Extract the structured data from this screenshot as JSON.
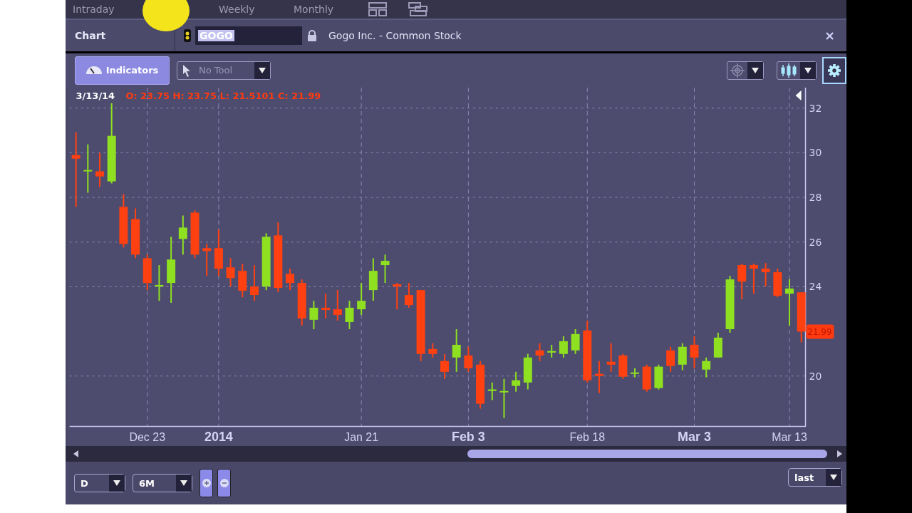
{
  "tabs": [
    {
      "label": "Intraday",
      "selected": false
    },
    {
      "label": "Weekly",
      "selected": false
    },
    {
      "label": "Monthly",
      "selected": false
    }
  ],
  "header": {
    "title": "Chart",
    "symbol": "GOGO",
    "company": "Gogo Inc. - Common Stock",
    "close": "×"
  },
  "toolbar": {
    "indicators": "Indicators",
    "tool": {
      "value": "No Tool",
      "disabled": true
    }
  },
  "chart": {
    "date": "3/13/14",
    "ohlc": "O: 23.75 H: 23.75 L: 21.5101 C: 21.99",
    "last_price": "21.99",
    "chart_data": {
      "type": "candlestick",
      "categories": [
        null,
        null,
        null,
        null,
        null,
        null,
        "Dec 23",
        null,
        null,
        null,
        null,
        null,
        "2014",
        null,
        null,
        null,
        null,
        null,
        null,
        null,
        null,
        null,
        null,
        null,
        "Jan 21",
        null,
        null,
        null,
        null,
        null,
        null,
        null,
        null,
        "Feb 3",
        null,
        null,
        null,
        null,
        null,
        null,
        null,
        null,
        null,
        "Feb 18",
        null,
        null,
        null,
        null,
        null,
        null,
        null,
        null,
        "Mar 3",
        null,
        null,
        null,
        null,
        null,
        null,
        null,
        "Mar 13",
        null
      ],
      "ohlc": [
        [
          29.9,
          30.92,
          27.58,
          29.74
        ],
        [
          29.2,
          30.38,
          28.21,
          29.23
        ],
        [
          29.17,
          30.0,
          28.47,
          28.94
        ],
        [
          28.72,
          32.22,
          28.63,
          30.76
        ],
        [
          27.58,
          28.15,
          25.76,
          25.92
        ],
        [
          27.03,
          27.51,
          25.28,
          25.44
        ],
        [
          25.28,
          25.44,
          23.85,
          24.17
        ],
        [
          24.01,
          24.97,
          23.37,
          24.08
        ],
        [
          24.17,
          26.24,
          23.28,
          25.22
        ],
        [
          26.14,
          27.19,
          25.44,
          26.65
        ],
        [
          27.32,
          27.42,
          25.28,
          25.44
        ],
        [
          25.73,
          25.92,
          24.49,
          25.6
        ],
        [
          25.73,
          26.56,
          24.49,
          24.81
        ],
        [
          24.87,
          25.28,
          24.01,
          24.39
        ],
        [
          24.71,
          25.03,
          23.53,
          23.82
        ],
        [
          24.01,
          24.97,
          23.37,
          23.63
        ],
        [
          24.01,
          26.4,
          23.85,
          26.24
        ],
        [
          26.3,
          26.88,
          23.76,
          23.95
        ],
        [
          24.58,
          24.81,
          23.85,
          24.17
        ],
        [
          24.17,
          24.33,
          22.26,
          22.58
        ],
        [
          22.52,
          23.37,
          22.1,
          23.06
        ],
        [
          23.06,
          23.69,
          22.58,
          22.96
        ],
        [
          22.99,
          23.85,
          22.48,
          22.74
        ],
        [
          22.42,
          23.37,
          22.1,
          23.06
        ],
        [
          22.99,
          24.17,
          22.74,
          23.37
        ],
        [
          23.85,
          25.28,
          23.37,
          24.71
        ],
        [
          24.97,
          25.44,
          24.17,
          25.16
        ],
        [
          24.11,
          24.17,
          22.99,
          24.01
        ],
        [
          23.63,
          24.17,
          23.06,
          23.18
        ],
        [
          23.85,
          23.85,
          20.67,
          20.99
        ],
        [
          21.21,
          21.47,
          20.83,
          20.99
        ],
        [
          20.67,
          20.99,
          19.87,
          20.19
        ],
        [
          20.83,
          22.1,
          20.19,
          21.4
        ],
        [
          20.92,
          21.31,
          20.19,
          20.35
        ],
        [
          20.51,
          20.67,
          18.54,
          18.76
        ],
        [
          19.33,
          19.71,
          18.92,
          19.4
        ],
        [
          19.27,
          19.87,
          18.12,
          19.33
        ],
        [
          19.56,
          20.19,
          19.3,
          19.81
        ],
        [
          19.71,
          20.99,
          19.4,
          20.83
        ],
        [
          21.15,
          21.47,
          20.67,
          20.92
        ],
        [
          21.05,
          21.4,
          20.83,
          21.12
        ],
        [
          20.99,
          21.78,
          20.83,
          21.56
        ],
        [
          21.15,
          22.1,
          20.99,
          21.88
        ],
        [
          22.04,
          22.48,
          19.71,
          19.81
        ],
        [
          20.1,
          20.67,
          19.24,
          20.0
        ],
        [
          20.64,
          21.47,
          20.19,
          20.51
        ],
        [
          20.92,
          20.99,
          19.87,
          19.97
        ],
        [
          20.1,
          20.35,
          19.94,
          20.16
        ],
        [
          20.42,
          20.51,
          19.3,
          19.4
        ],
        [
          19.46,
          20.51,
          19.4,
          20.42
        ],
        [
          21.15,
          21.31,
          20.19,
          20.45
        ],
        [
          20.51,
          21.47,
          20.26,
          21.31
        ],
        [
          21.4,
          21.78,
          20.35,
          20.83
        ],
        [
          20.29,
          20.83,
          19.94,
          20.67
        ],
        [
          20.83,
          21.94,
          20.83,
          21.72
        ],
        [
          22.1,
          24.49,
          21.94,
          24.33
        ],
        [
          24.97,
          25.03,
          23.44,
          24.23
        ],
        [
          24.97,
          25.03,
          23.69,
          24.81
        ],
        [
          24.81,
          25.06,
          24.01,
          24.65
        ],
        [
          24.65,
          24.81,
          23.53,
          23.6
        ],
        [
          23.69,
          24.33,
          22.26,
          23.92
        ],
        [
          23.75,
          23.75,
          21.51,
          21.99
        ]
      ],
      "ylim": [
        17.74,
        32.92
      ],
      "yticks": [
        32,
        30,
        28,
        26,
        24,
        20
      ],
      "grid": true
    },
    "date_label_styles": [
      {
        "major": false
      },
      {
        "major": true
      },
      {
        "major": false
      },
      {
        "major": true
      },
      {
        "major": false
      },
      {
        "major": true
      },
      {
        "major": false
      }
    ]
  },
  "bottom": {
    "interval": "D",
    "range": "6M",
    "price_field": "last"
  }
}
